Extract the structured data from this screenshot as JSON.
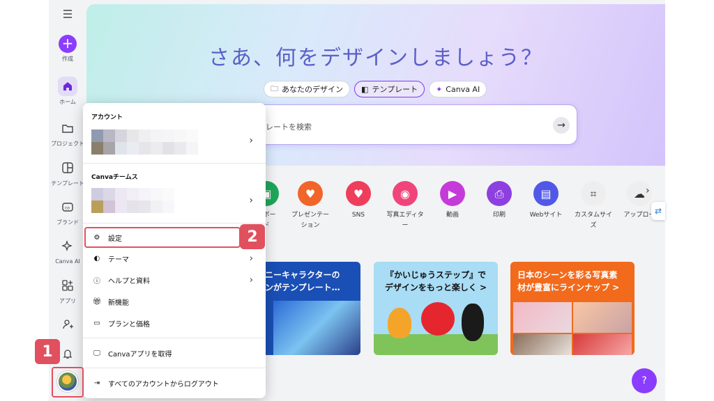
{
  "sidebar": {
    "create_label": "作成",
    "items": [
      {
        "label": "ホーム",
        "icon": "home-icon"
      },
      {
        "label": "プロジェクト",
        "icon": "folder-icon"
      },
      {
        "label": "テンプレート",
        "icon": "template-icon"
      },
      {
        "label": "ブランド",
        "icon": "brand-icon"
      },
      {
        "label": "Canva AI",
        "icon": "sparkle-icon"
      },
      {
        "label": "アプリ",
        "icon": "apps-icon"
      }
    ]
  },
  "hero": {
    "title": "さあ、何をデザインしましょう？",
    "pills": [
      "あなたのデザイン",
      "テンプレート",
      "Canva AI"
    ],
    "search_placeholder": "レートを検索"
  },
  "categories": [
    {
      "label": "トボー\nド",
      "color": "#1ea65a"
    },
    {
      "label": "プレゼンテー\nション",
      "color": "#f1642a"
    },
    {
      "label": "SNS",
      "color": "#ef3e5b"
    },
    {
      "label": "写真エディタ\nー",
      "color": "#f0457a"
    },
    {
      "label": "動画",
      "color": "#c53bd9"
    },
    {
      "label": "印刷",
      "color": "#8e3fe0"
    },
    {
      "label": "Webサイト",
      "color": "#5158e8"
    },
    {
      "label": "カスタムサイ\nズ",
      "color": "#eeeeee"
    },
    {
      "label": "アップロー",
      "color": "#eeeeee"
    }
  ],
  "cards": [
    {
      "title": "ズニーキャラクターの\nインがテンプレート…"
    },
    {
      "title": "『かいじゅうステップ』で\nデザインをもっと楽しく >"
    },
    {
      "title": "日本のシーンを彩る写真素\n材が豊富にラインナップ >"
    }
  ],
  "menu": {
    "account_header": "アカウント",
    "team_header": "Canvaチームス",
    "items": {
      "settings": "設定",
      "theme": "テーマ",
      "help": "ヘルプと資料",
      "new_features": "新機能",
      "plans": "プランと価格",
      "get_app": "Canvaアプリを取得",
      "logout": "すべてのアカウントからログアウト"
    }
  },
  "badges": {
    "one": "1",
    "two": "2"
  },
  "help_button": "?",
  "colors": {
    "accent": "#8b3dff",
    "highlight": "#e0505e"
  }
}
